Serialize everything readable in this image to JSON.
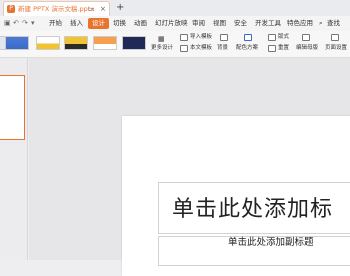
{
  "document_tab": {
    "name": "新建 PPTX 演示文稿.pptx",
    "icon": "presentation-file-icon",
    "pin_icon": "monitor-icon",
    "close": "×"
  },
  "new_tab": "+",
  "menu": {
    "items": [
      "开始",
      "插入",
      "设计",
      "切换",
      "动画",
      "幻灯片放映",
      "审阅",
      "视图",
      "安全",
      "开发工具",
      "特色应用"
    ],
    "active": "设计",
    "search": "查找",
    "quick_access": [
      "↶",
      "↷",
      "▾"
    ]
  },
  "ribbon": {
    "more_designs": "更多设计",
    "import_template": "导入模板",
    "text_template": "本文模板",
    "background": "背景",
    "color_scheme": "配色方案",
    "layout": "版式",
    "rearrange": "重置",
    "edit_master": "编辑母版",
    "page_setup": "页面设置"
  },
  "theme_colors": [
    "#dfe7f3",
    "#3b6bc7",
    "#f1c232",
    "#f6a04d",
    "#1f2b56"
  ],
  "slide": {
    "title_placeholder": "单击此处添加标",
    "subtitle_placeholder": "单击此处添加副标题"
  },
  "accent_color": "#e8752f"
}
